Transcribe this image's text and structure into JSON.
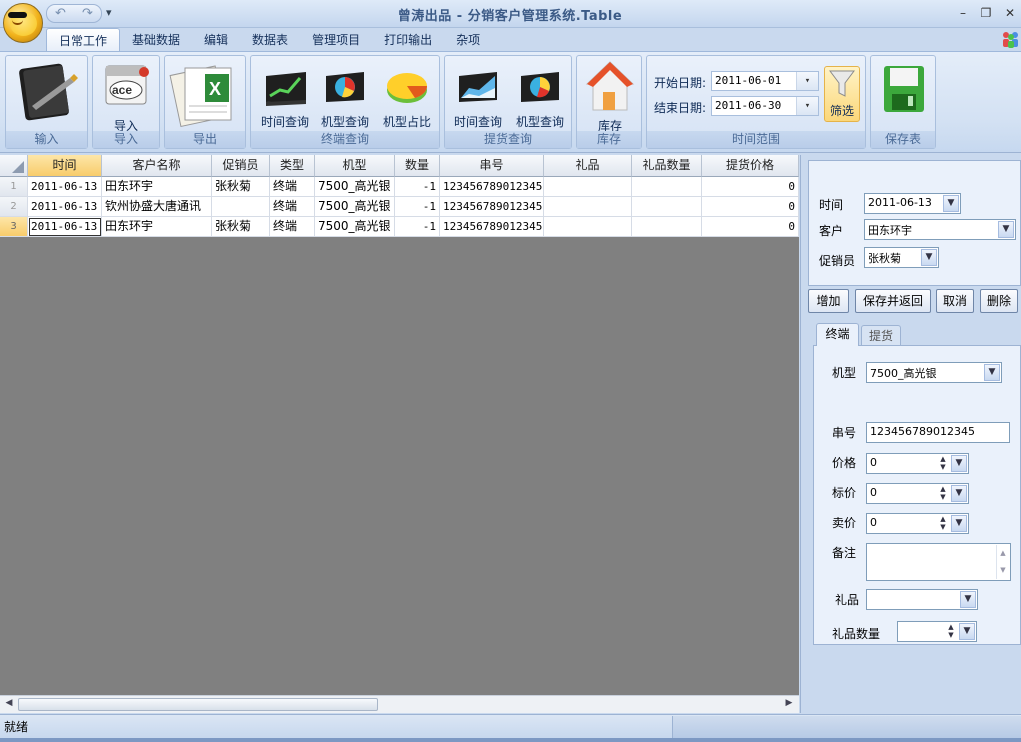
{
  "window": {
    "title": "曾涛出品 - 分销客户管理系统.Table",
    "qat_more": "▾",
    "controls": {
      "minimize": "–",
      "restore": "❐",
      "close": "✕"
    }
  },
  "ribbon": {
    "tabs": [
      "日常工作",
      "基础数据",
      "编辑",
      "数据表",
      "管理项目",
      "打印输出",
      "杂项"
    ],
    "active_tab": "日常工作",
    "groups": {
      "input": {
        "label": "输入"
      },
      "import": {
        "label": "导入",
        "button": "导入"
      },
      "export": {
        "label": "导出"
      },
      "terminal_query": {
        "label": "终端查询",
        "buttons": [
          "时间查询",
          "机型查询",
          "机型占比"
        ]
      },
      "pickup_query": {
        "label": "提货查询",
        "buttons": [
          "时间查询",
          "机型查询"
        ]
      },
      "inventory": {
        "label": "库存",
        "button": "库存"
      },
      "time_range": {
        "label": "时间范围",
        "start_label": "开始日期:",
        "start_value": "2011-06-01",
        "end_label": "结束日期:",
        "end_value": "2011-06-30",
        "filter_button": "筛选"
      },
      "save_table": {
        "label": "保存表"
      }
    }
  },
  "grid": {
    "columns": [
      "时间",
      "客户名称",
      "促销员",
      "类型",
      "机型",
      "数量",
      "串号",
      "礼品",
      "礼品数量",
      "提货价格"
    ],
    "rows": [
      {
        "num": "1",
        "cells": [
          "2011-06-13",
          "田东环宇",
          "张秋菊",
          "终端",
          "7500_高光银",
          "-1",
          "123456789012345",
          "",
          "",
          "0"
        ]
      },
      {
        "num": "2",
        "cells": [
          "2011-06-13",
          "钦州协盛大唐通讯",
          "",
          "终端",
          "7500_高光银",
          "-1",
          "123456789012345",
          "",
          "",
          "0"
        ]
      },
      {
        "num": "3",
        "cells": [
          "2011-06-13",
          "田东环宇",
          "张秋菊",
          "终端",
          "7500_高光银",
          "-1",
          "123456789012345",
          "",
          "",
          "0"
        ]
      }
    ]
  },
  "detail": {
    "time_label": "时间",
    "time_value": "2011-06-13",
    "customer_label": "客户",
    "customer_value": "田东环宇",
    "promoter_label": "促销员",
    "promoter_value": "张秋菊",
    "buttons": {
      "add": "增加",
      "save_return": "保存并返回",
      "cancel": "取消",
      "delete": "删除"
    },
    "tabs": [
      "终端",
      "提货"
    ],
    "active_tab": "终端",
    "model_label": "机型",
    "model_value": "7500_高光银",
    "serial_label": "串号",
    "serial_value": "123456789012345",
    "price_label": "价格",
    "price_value": "0",
    "list_price_label": "标价",
    "list_price_value": "0",
    "sell_price_label": "卖价",
    "sell_price_value": "0",
    "note_label": "备注",
    "note_value": "",
    "gift_label": "礼品",
    "gift_value": "",
    "gift_qty_label": "礼品数量",
    "gift_qty_value": ""
  },
  "status": {
    "text": "就绪"
  },
  "colors": {
    "ribbon_bg": "#d3e1f3",
    "grid_bg": "#808080",
    "highlight": "#f8cc6b",
    "title_text": "#3b5a86"
  }
}
